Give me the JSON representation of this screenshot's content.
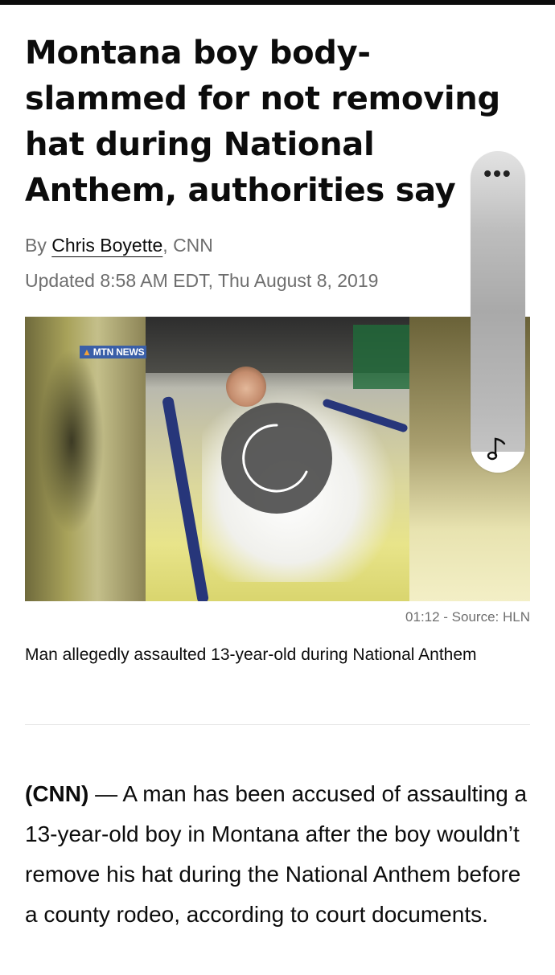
{
  "article": {
    "headline": "Montana boy body-slammed for not removing hat during National Anthem, authorities say",
    "byline_prefix": "By ",
    "author": "Chris Boyette",
    "byline_suffix": ", CNN",
    "updated": "Updated 8:58 AM EDT, Thu August 8, 2019"
  },
  "video": {
    "overlay_badge": "MTN NEWS",
    "duration_source": "01:12 - Source: HLN",
    "caption": "Man allegedly assaulted 13-year-old during National Anthem"
  },
  "body": {
    "dateline": "(CNN)",
    "dash": " — ",
    "paragraph": "A man has been accused of assaulting a 13-year-old boy in Montana after the boy wouldn’t remove his hat during the National Anthem before a county rodeo, according to court documents."
  },
  "scroller": {
    "menu_label": "•••",
    "icon": "music-note-icon"
  },
  "colors": {
    "text": "#0c0c0c",
    "meta": "#6e6e6e",
    "badge_bg": "#3a5fa8"
  }
}
